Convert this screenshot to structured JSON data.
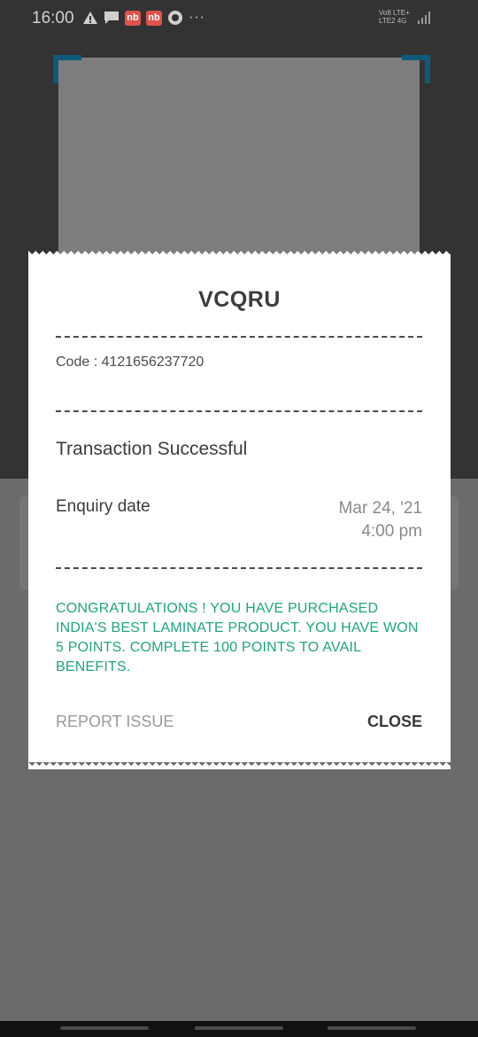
{
  "status_bar": {
    "time": "16:00",
    "badge_a": "nb",
    "badge_b": "nb",
    "more": "···",
    "network_line1": "Vo8 LTE+",
    "network_line2": "LTE2 4G"
  },
  "scanner": {
    "accent_color": "#0e5a78"
  },
  "receipt": {
    "brand": "VCQRU",
    "code_text": "Code : 4121656237720",
    "status": "Transaction Successful",
    "enquiry_label": "Enquiry date",
    "enquiry_date": "Mar 24, '21",
    "enquiry_time": "4:00 pm",
    "message": "CONGRATULATIONS ! YOU HAVE PURCHASED INDIA'S BEST LAMINATE PRODUCT. YOU HAVE WON 5 POINTS. COMPLETE 100 POINTS TO AVAIL BENEFITS.",
    "message_color": "#1fa581",
    "report_label": "REPORT ISSUE",
    "close_label": "CLOSE"
  }
}
